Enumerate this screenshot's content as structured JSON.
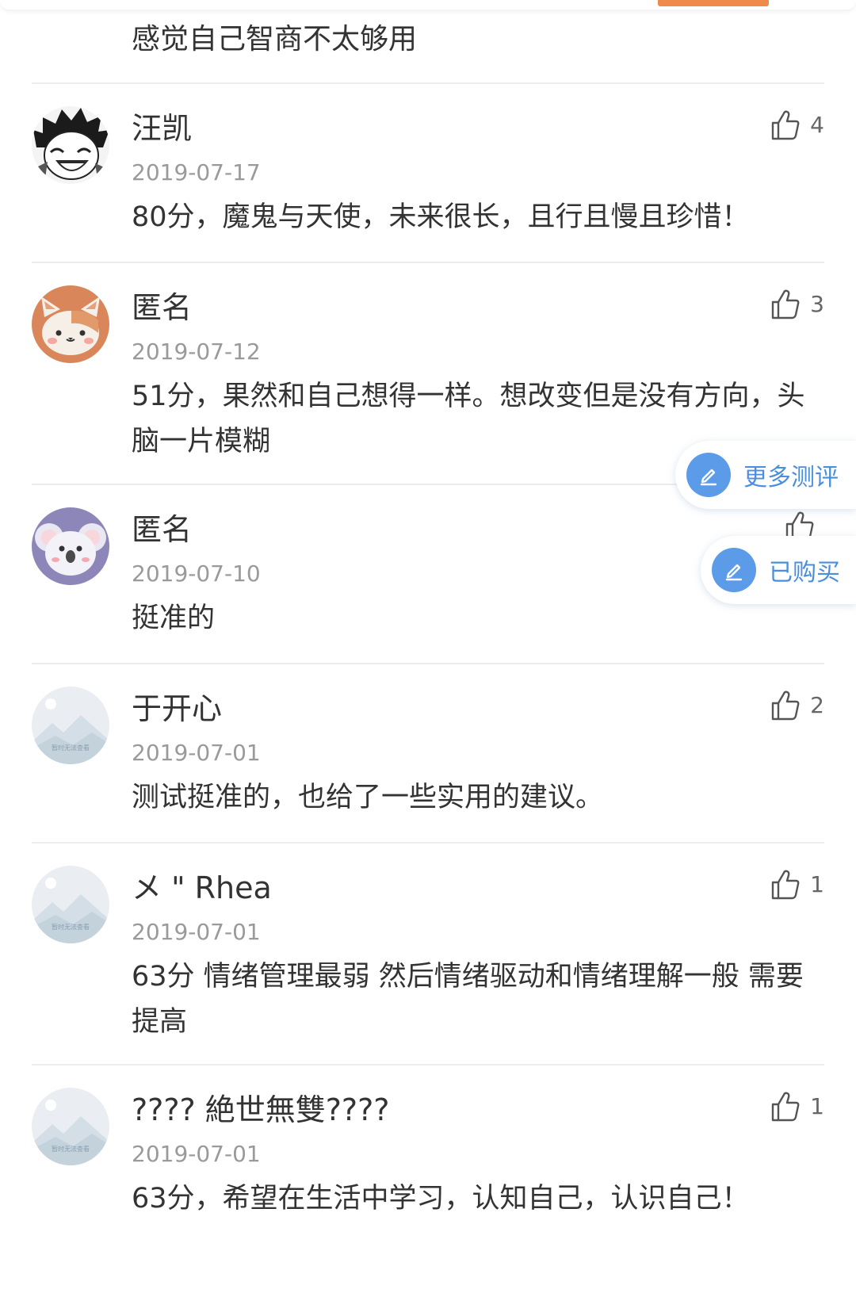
{
  "top_comment": {
    "text": "感觉自己智商不太够用"
  },
  "comments": [
    {
      "name": "汪凯",
      "date": "2019-07-17",
      "text": "80分，魔鬼与天使，未来很长，且行且慢且珍惜！",
      "likes": "4",
      "avatar": "manga-avatar"
    },
    {
      "name": "匿名",
      "date": "2019-07-12",
      "text": "51分，果然和自己想得一样。想改变但是没有方向，头脑一片模糊",
      "likes": "3",
      "avatar": "cat-avatar"
    },
    {
      "name": "匿名",
      "date": "2019-07-10",
      "text": "挺准的",
      "likes": "",
      "avatar": "koala-avatar"
    },
    {
      "name": "于开心",
      "date": "2019-07-01",
      "text": "测试挺准的，也给了一些实用的建议。",
      "likes": "2",
      "avatar": "placeholder-avatar"
    },
    {
      "name": "メ \" Rhea",
      "date": "2019-07-01",
      "text": "63分 情绪管理最弱 然后情绪驱动和情绪理解一般 需要提高",
      "likes": "1",
      "avatar": "placeholder-avatar"
    },
    {
      "name": "???? 絶世無雙????",
      "date": "2019-07-01",
      "text": "63分，希望在生活中学习，认知自己，认识自己！",
      "likes": "1",
      "avatar": "placeholder-avatar"
    }
  ],
  "floating_buttons": {
    "more_tests": "更多测评",
    "purchased": "已购买"
  },
  "placeholder_avatar_caption": "暂时无法查看",
  "colors": {
    "accent_orange": "#ef8a4c",
    "accent_blue": "#5b9be8",
    "date_gray": "#9a9a9a",
    "text": "#333333",
    "divider": "#ededed"
  }
}
